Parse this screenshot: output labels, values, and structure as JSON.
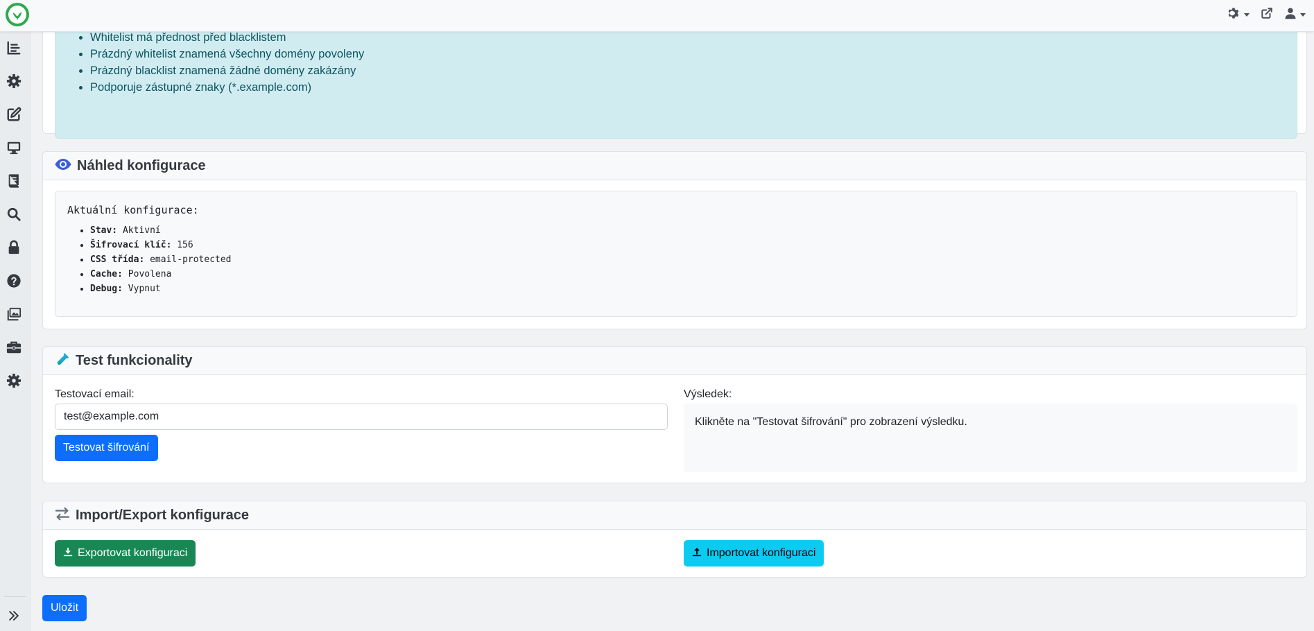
{
  "info": {
    "items": [
      "Whitelist má přednost před blacklistem",
      "Prázdný whitelist znamená všechny domény povoleny",
      "Prázdný blacklist znamená žádné domény zakázány",
      "Podporuje zástupné znaky (*.example.com)"
    ]
  },
  "preview": {
    "title": "Náhled konfigurace",
    "heading": "Aktuální konfigurace:",
    "rows": [
      {
        "key": "Stav:",
        "value": "Aktivní"
      },
      {
        "key": "Šifrovací klíč:",
        "value": "156"
      },
      {
        "key": "CSS třída:",
        "value": "email-protected"
      },
      {
        "key": "Cache:",
        "value": "Povolena"
      },
      {
        "key": "Debug:",
        "value": "Vypnut"
      }
    ]
  },
  "test": {
    "title": "Test funkcionality",
    "email_label": "Testovací email:",
    "email_value": "test@example.com",
    "button": "Testovat šifrování",
    "result_label": "Výsledek:",
    "result_text": "Klikněte na \"Testovat šifrování\" pro zobrazení výsledku."
  },
  "import_export": {
    "title": "Import/Export konfigurace",
    "export_button": "Exportovat konfiguraci",
    "import_button": "Importovat konfiguraci"
  },
  "save_button": "Uložit",
  "colors": {
    "primary": "#0d6efd",
    "success": "#198754",
    "info": "#0dcaf0",
    "brand": "#2fa84f",
    "eye_icon": "#3d5ed6",
    "flask_icon": "#1ba8d6",
    "arrows_icon": "#6c757d"
  },
  "icons": {
    "topbar": [
      "gear-icon",
      "external-link-icon",
      "user-icon"
    ],
    "sidebar": [
      "list-icon",
      "gear-icon",
      "edit-icon",
      "desktop-icon",
      "book-icon",
      "search-icon",
      "lock-icon",
      "question-icon",
      "images-icon",
      "toolbox-icon",
      "cog-icon",
      "expand-icon"
    ]
  }
}
